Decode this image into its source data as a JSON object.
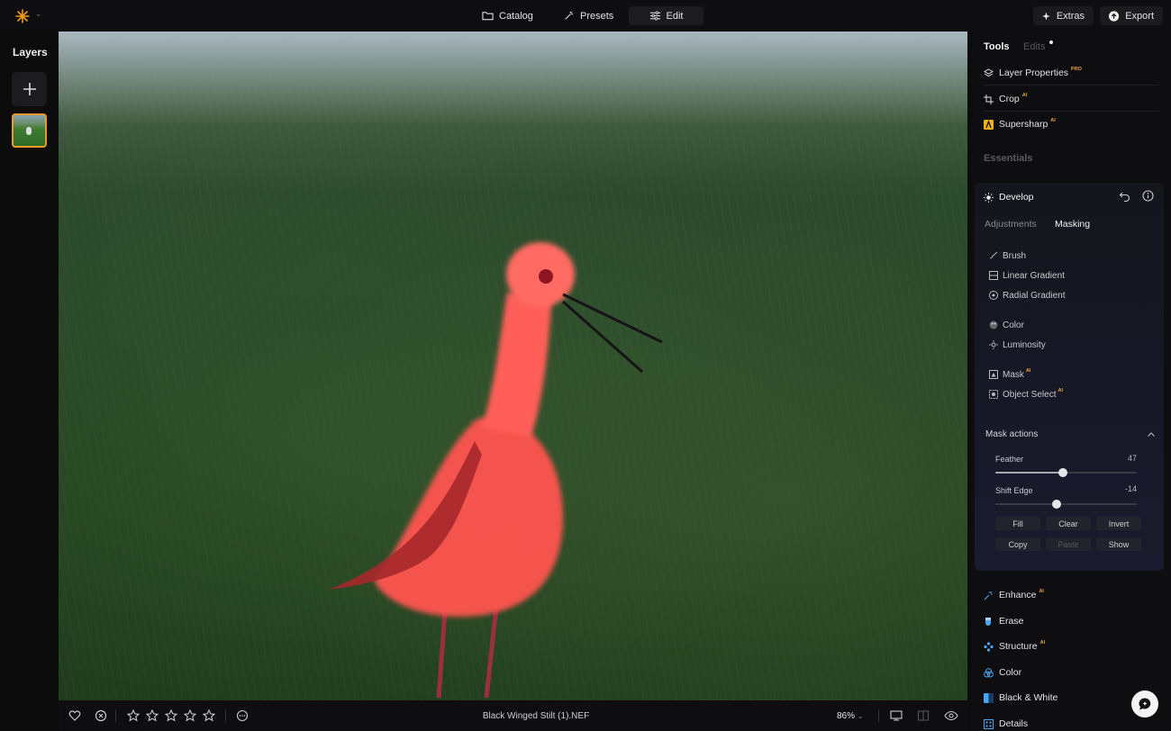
{
  "topbar": {
    "nav": [
      {
        "label": "Catalog",
        "icon": "folder-icon"
      },
      {
        "label": "Presets",
        "icon": "sparkle-wand-icon"
      },
      {
        "label": "Edit",
        "icon": "sliders-icon",
        "active": true
      }
    ],
    "extras_label": "Extras",
    "export_label": "Export"
  },
  "layers": {
    "title": "Layers"
  },
  "canvas": {
    "subject": "bird-with-red-mask-overlay",
    "mask_color": "#ff4a44"
  },
  "bottombar": {
    "filename": "Black Winged Stilt (1).NEF",
    "zoom": "86%",
    "rating_stars": 0
  },
  "right_panel": {
    "tabs": {
      "tools": "Tools",
      "edits": "Edits"
    },
    "tools": [
      {
        "label": "Layer Properties",
        "badge": "PRO"
      },
      {
        "label": "Crop",
        "badge": "AI"
      },
      {
        "label": "Supersharp",
        "badge": "AI"
      }
    ],
    "essentials_label": "Essentials",
    "develop": {
      "title": "Develop",
      "subtabs": {
        "adjustments": "Adjustments",
        "masking": "Masking"
      },
      "mask_tools": [
        {
          "label": "Brush",
          "icon": "brush-icon"
        },
        {
          "label": "Linear Gradient",
          "icon": "linear-gradient-icon"
        },
        {
          "label": "Radial Gradient",
          "icon": "radial-gradient-icon"
        },
        {
          "label": "Color",
          "icon": "color-palette-icon"
        },
        {
          "label": "Luminosity",
          "icon": "sun-icon"
        },
        {
          "label": "Mask",
          "icon": "mask-icon",
          "badge": "AI"
        },
        {
          "label": "Object Select",
          "icon": "object-select-icon",
          "badge": "AI"
        }
      ],
      "mask_actions": {
        "title": "Mask actions",
        "feather": {
          "label": "Feather",
          "value": "47"
        },
        "shift_edge": {
          "label": "Shift Edge",
          "value": "-14"
        },
        "buttons": [
          "Fill",
          "Clear",
          "Invert",
          "Copy",
          "Paste",
          "Show"
        ]
      }
    },
    "more_tools": [
      {
        "label": "Enhance",
        "badge": "AI"
      },
      {
        "label": "Erase"
      },
      {
        "label": "Structure",
        "badge": "AI"
      },
      {
        "label": "Color"
      },
      {
        "label": "Black & White"
      },
      {
        "label": "Details"
      }
    ],
    "accent": "#e9a23b"
  }
}
